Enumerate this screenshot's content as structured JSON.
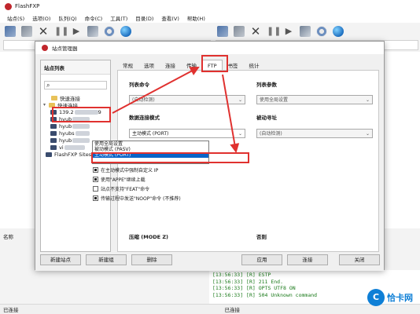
{
  "app": {
    "title": "FlashFXP",
    "menu": [
      "站点(S)",
      "选项(O)",
      "队列(Q)",
      "命令(C)",
      "工具(T)",
      "目录(D)",
      "查看(V)",
      "帮助(H)"
    ],
    "left_column_header": "名称",
    "status_left": "已连接",
    "status_right": "已连接"
  },
  "log": {
    "lines": [
      "[13:56:33] [R] ESTP",
      "[13:56:33] [R] 211 End.",
      "[13:56:33] [R] OPTS UTF8 ON",
      "[13:56:33] [R] 504 Unknown command"
    ]
  },
  "dialog": {
    "title": "站点管理器",
    "site_list_header": "站点列表",
    "tree": [
      {
        "label": "快速连接",
        "kind": "folder"
      },
      {
        "label": "快速连接",
        "kind": "folder"
      },
      {
        "label": "139.2",
        "suffix": "9",
        "kind": "server"
      },
      {
        "label": "hyub",
        "kind": "server"
      },
      {
        "label": "hyub",
        "kind": "server"
      },
      {
        "label": "hyubs",
        "kind": "server"
      },
      {
        "label": "hyub",
        "kind": "server"
      },
      {
        "label": "vi",
        "kind": "server"
      },
      {
        "label": "FlashFXP Sites",
        "kind": "folder"
      }
    ],
    "tabs": [
      "常规",
      "选项",
      "连接",
      "传输",
      "FTP",
      "书签",
      "统计"
    ],
    "active_tab": "FTP",
    "list_command_label": "列表命令",
    "list_command_value": "(自动检测)",
    "list_params_label": "列表参数",
    "list_params_value": "使用全局设置",
    "data_mode_label": "数据连接模式",
    "data_mode_value": "主动模式 (PORT)",
    "list_mode_label": "被动寻址",
    "list_mode_value": "(自动检测)",
    "dropdown_options": [
      "使用全局设置",
      "被动模式 (PASV)",
      "主动模式 (PORT)"
    ],
    "checkboxes": [
      {
        "label": "在主动模式中强制自定义 IP",
        "checked": true
      },
      {
        "label": "使用\"APPE\"继续上载",
        "checked": true
      },
      {
        "label": "站点不支持\"FEAT\"命令",
        "checked": false
      },
      {
        "label": "传输过程中发送\"NOOP\"命令 (不推荐)",
        "checked": true
      }
    ],
    "compression_label": "压缩 (MODE Z)",
    "proxy_label": "否则",
    "buttons": {
      "new_site": "新建站点",
      "new_group": "新建组",
      "delete": "删除",
      "apply": "应用",
      "connect": "连接",
      "close": "关闭"
    }
  },
  "watermark": {
    "text": "恰卡网",
    "circle": "C"
  }
}
